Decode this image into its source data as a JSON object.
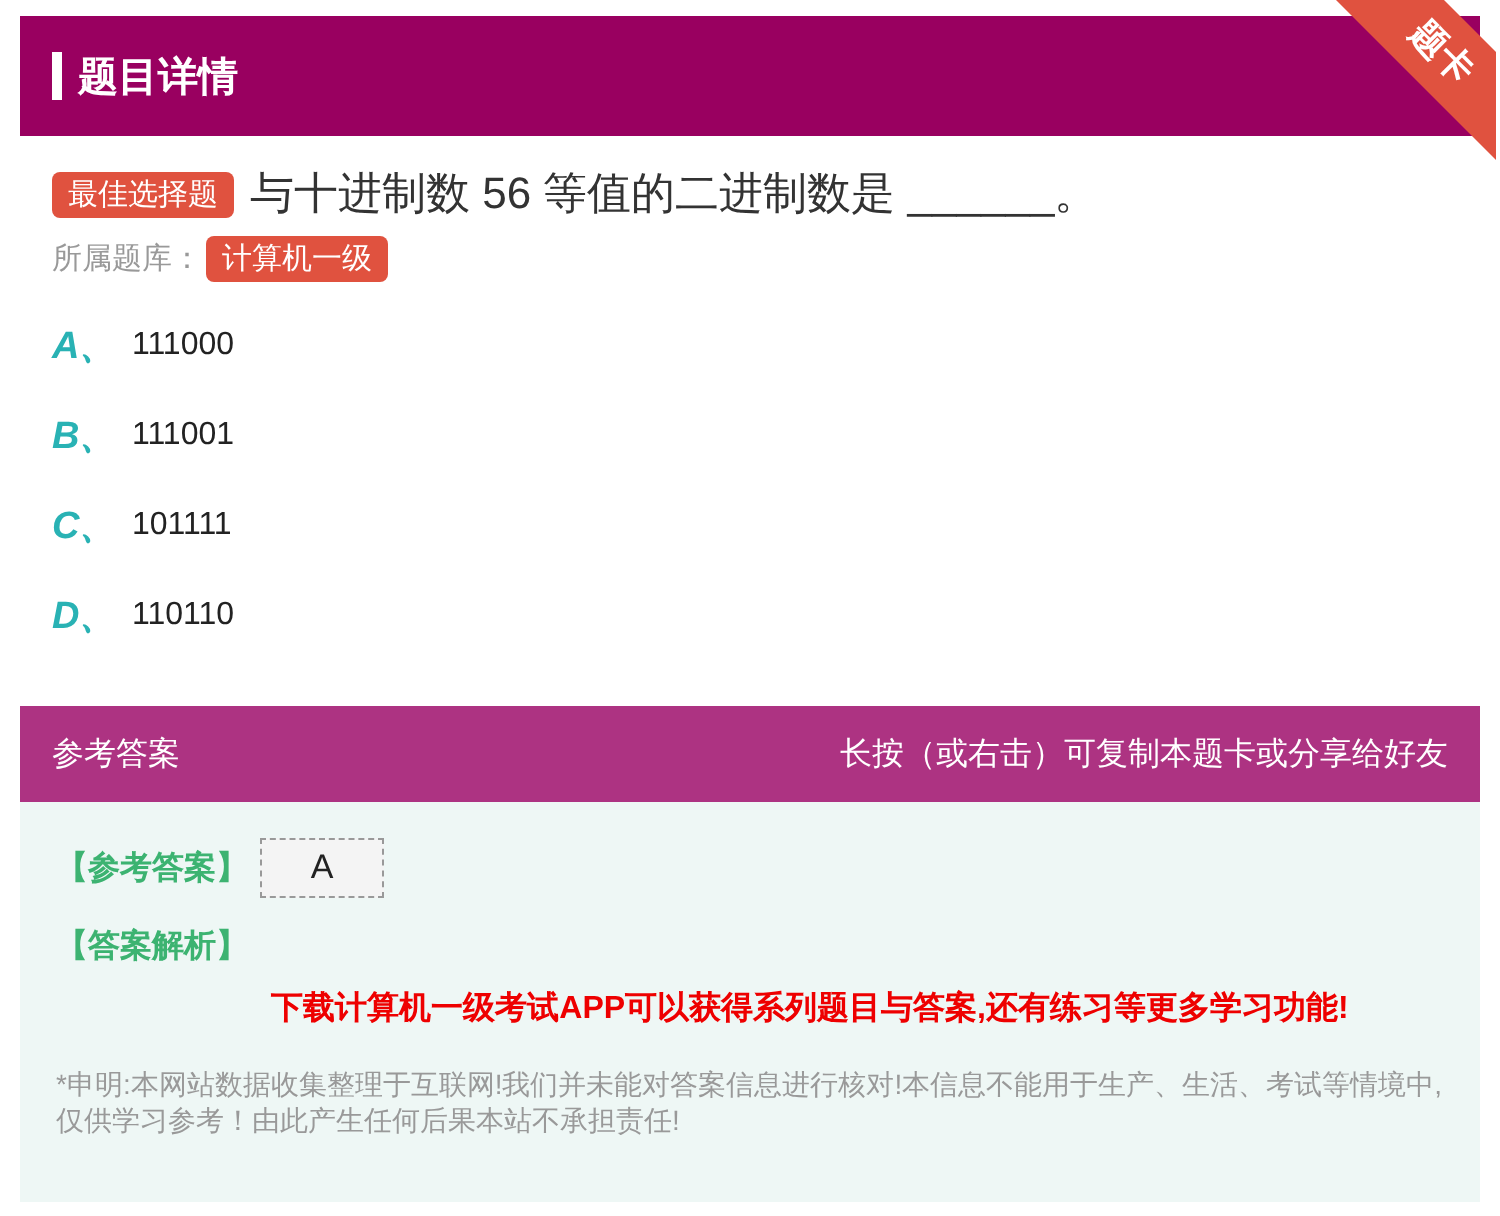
{
  "header": {
    "title": "题目详情",
    "ribbon": "题卡"
  },
  "question": {
    "type_badge": "最佳选择题",
    "text": "与十进制数 56 等值的二进制数是 ______。",
    "bank_label": "所属题库：",
    "bank": "计算机一级"
  },
  "options": [
    {
      "letter": "A、",
      "text": "111000"
    },
    {
      "letter": "B、",
      "text": "111001"
    },
    {
      "letter": "C、",
      "text": "101111"
    },
    {
      "letter": "D、",
      "text": "110110"
    }
  ],
  "answer": {
    "title": "参考答案",
    "hint": "长按（或右击）可复制本题卡或分享给好友",
    "answer_label": "【参考答案】",
    "answer_value": "A",
    "analysis_label": "【答案解析】",
    "promo": "下载计算机一级考试APP可以获得系列题目与答案,还有练习等更多学习功能!",
    "disclaimer": "*申明:本网站数据收集整理于互联网!我们并未能对答案信息进行核对!本信息不能用于生产、生活、考试等情境中,仅供学习参考！由此产生任何后果本站不承担责任!"
  }
}
